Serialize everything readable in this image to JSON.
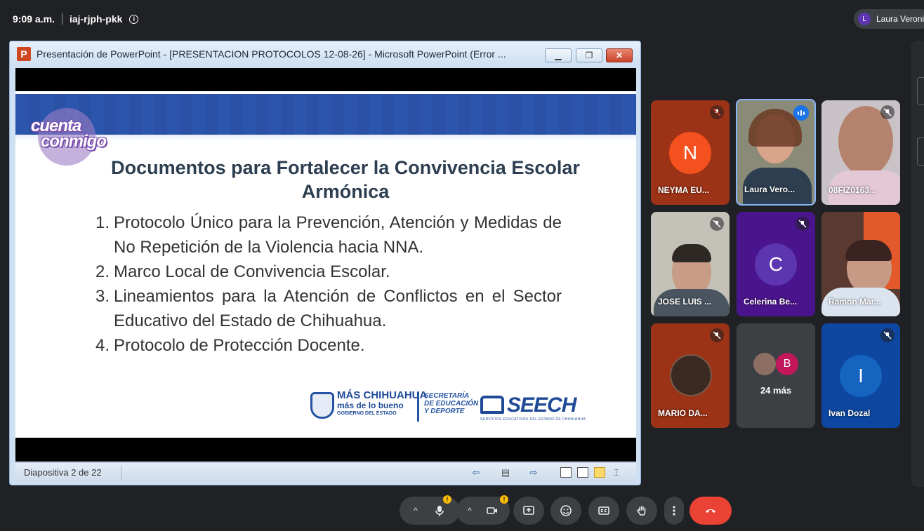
{
  "meeting": {
    "time": "9:09 a.m.",
    "code": "iaj-rjph-pkk",
    "user_initial": "L",
    "user_name": "Laura Veroni"
  },
  "ppt": {
    "window_title": "Presentación de PowerPoint - [PRESENTACION PROTOCOLOS 12-08-26] - Microsoft PowerPoint (Error ...",
    "status_slide": "Diapositiva 2 de 22"
  },
  "slide": {
    "badge_line1": "cuenta",
    "badge_line2": "conmigo",
    "title": "Documentos para Fortalecer la Convivencia Escolar Armónica",
    "items": [
      {
        "num": "1.",
        "text": "Protocolo Único para la Prevención, Atención y Medidas de No Repetición de la Violencia hacia NNA."
      },
      {
        "num": "2.",
        "text": "Marco Local de Convivencia Escolar."
      },
      {
        "num": "3.",
        "text": "Lineamientos para la Atención de Conflictos en el Sector Educativo del Estado de Chihuahua."
      },
      {
        "num": "4.",
        "text": "Protocolo de Protección Docente."
      }
    ],
    "logo_mas": "MÁS CHIHUAHUA",
    "logo_mas_sub": "más de lo bueno",
    "logo_gob": "GOBIERNO DEL ESTADO",
    "logo_sec_1": "SECRETARÍA",
    "logo_sec_2": "DE EDUCACIÓN",
    "logo_sec_3": "Y DEPORTE",
    "logo_seech": "SEECH",
    "logo_seech_sub": "SERVICIOS EDUCATIVOS DEL ESTADO DE CHIHUAHUA"
  },
  "participants": [
    {
      "name": "NEYMA EU...",
      "initial": "N",
      "color": "#f4511e",
      "bg": "#9c3216"
    },
    {
      "name": "Laura Vero..."
    },
    {
      "name": "08FIZ0163..."
    },
    {
      "name": "JOSE LUIS ..."
    },
    {
      "name": "Celerina Be...",
      "initial": "C",
      "color": "#5e35b1",
      "bg": "#4a148c"
    },
    {
      "name": "Ramon Mar..."
    },
    {
      "name": "MARIO DA..."
    },
    {
      "name": "24 más",
      "initial": "B",
      "color": "#c2185b"
    },
    {
      "name": "Ivan Dozal",
      "initial": "I",
      "color": "#1565c0",
      "bg": "#0d47a1"
    }
  ],
  "colors": {
    "meet_bg": "#202124",
    "control_bg": "#3c4043",
    "hangup": "#ea4335",
    "warning": "#fbbc04",
    "slide_band": "#2c56ad"
  }
}
